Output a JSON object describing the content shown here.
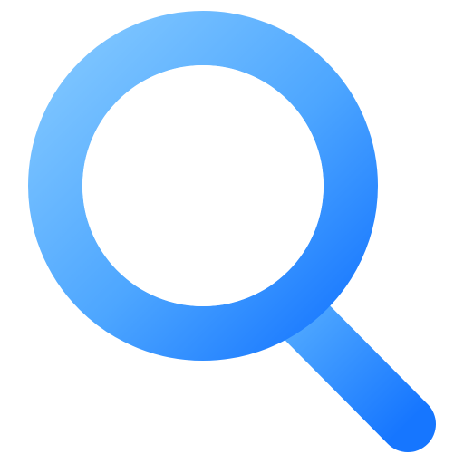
{
  "icon": {
    "name": "search-icon",
    "depicts": "magnifying-glass",
    "colors": {
      "gradient_start": "#82C8FF",
      "gradient_mid": "#4DA6FF",
      "gradient_end": "#1676FF",
      "lens_fill": "#FFFFFF",
      "background": "#FFFFFF"
    }
  }
}
